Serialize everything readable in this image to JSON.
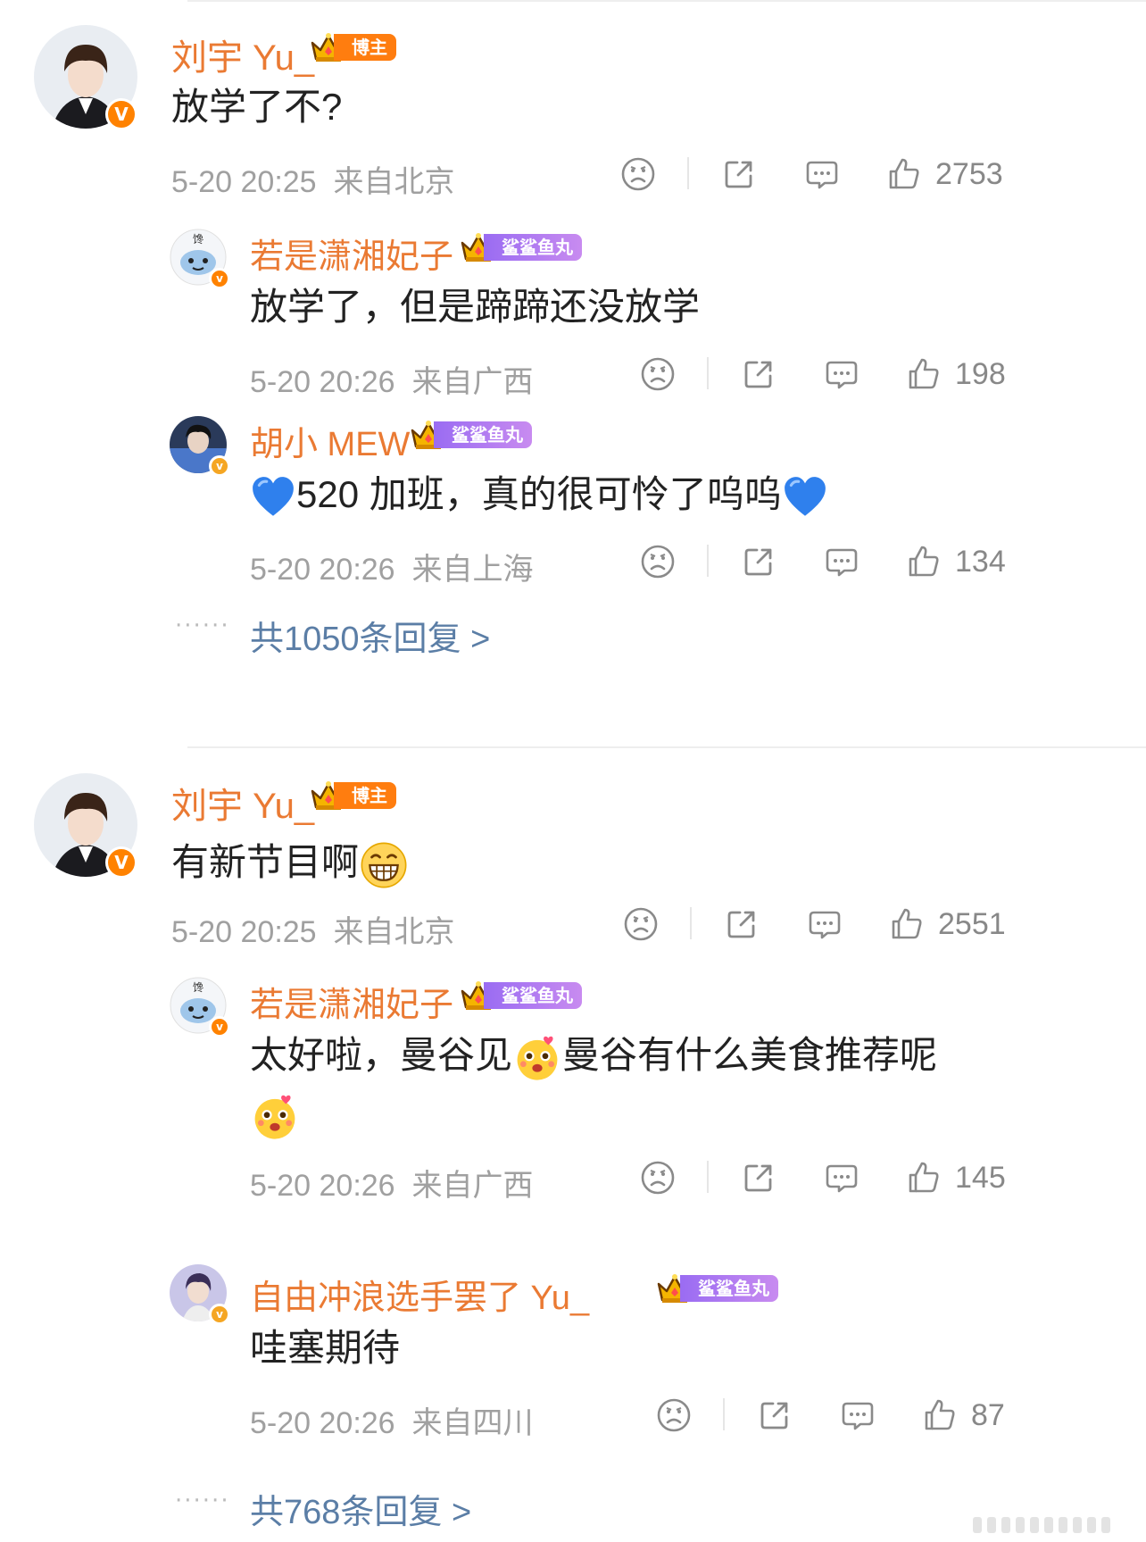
{
  "colors": {
    "name": "#ea7a33",
    "meta": "#a0a0a0",
    "more": "#5b7ea6",
    "blogger_badge": "#ff7d0f",
    "fan_badge": "#a874f0"
  },
  "threads": [
    {
      "name": "刘宇 Yu_",
      "badge": "博主",
      "text": "放学了不?",
      "time": "5-20 20:25",
      "location": "来自北京",
      "likes": "2753",
      "replies": [
        {
          "name": "若是潇湘妃子",
          "badge": "鲨鲨鱼丸",
          "text": "放学了，但是蹄蹄还没放学",
          "time": "5-20 20:26",
          "location": "来自广西",
          "likes": "198"
        },
        {
          "name": "胡小 MEW",
          "badge": "鲨鲨鱼丸",
          "text": "520 加班，真的很可怜了呜呜",
          "time": "5-20 20:26",
          "location": "来自上海",
          "likes": "134"
        }
      ],
      "more": "共1050条回复 >"
    },
    {
      "name": "刘宇 Yu_",
      "badge": "博主",
      "text": "有新节目啊",
      "time": "5-20 20:25",
      "location": "来自北京",
      "likes": "2551",
      "replies": [
        {
          "name": "若是潇湘妃子",
          "badge": "鲨鲨鱼丸",
          "text_a": "太好啦，曼谷见",
          "text_b": "曼谷有什么美食推荐呢",
          "time": "5-20 20:26",
          "location": "来自广西",
          "likes": "145"
        },
        {
          "name": "自由冲浪选手罢了 Yu_",
          "badge": "鲨鲨鱼丸",
          "text": "哇塞期待",
          "time": "5-20 20:26",
          "location": "来自四川",
          "likes": "87"
        }
      ],
      "more": "共768条回复 >"
    }
  ],
  "dots": "······",
  "icons": [
    "sad-face-icon",
    "share-icon",
    "comment-icon",
    "thumbs-up-icon",
    "blue-heart-icon",
    "grin-emoji-icon",
    "cute-emoji-icon",
    "crown-icon"
  ]
}
